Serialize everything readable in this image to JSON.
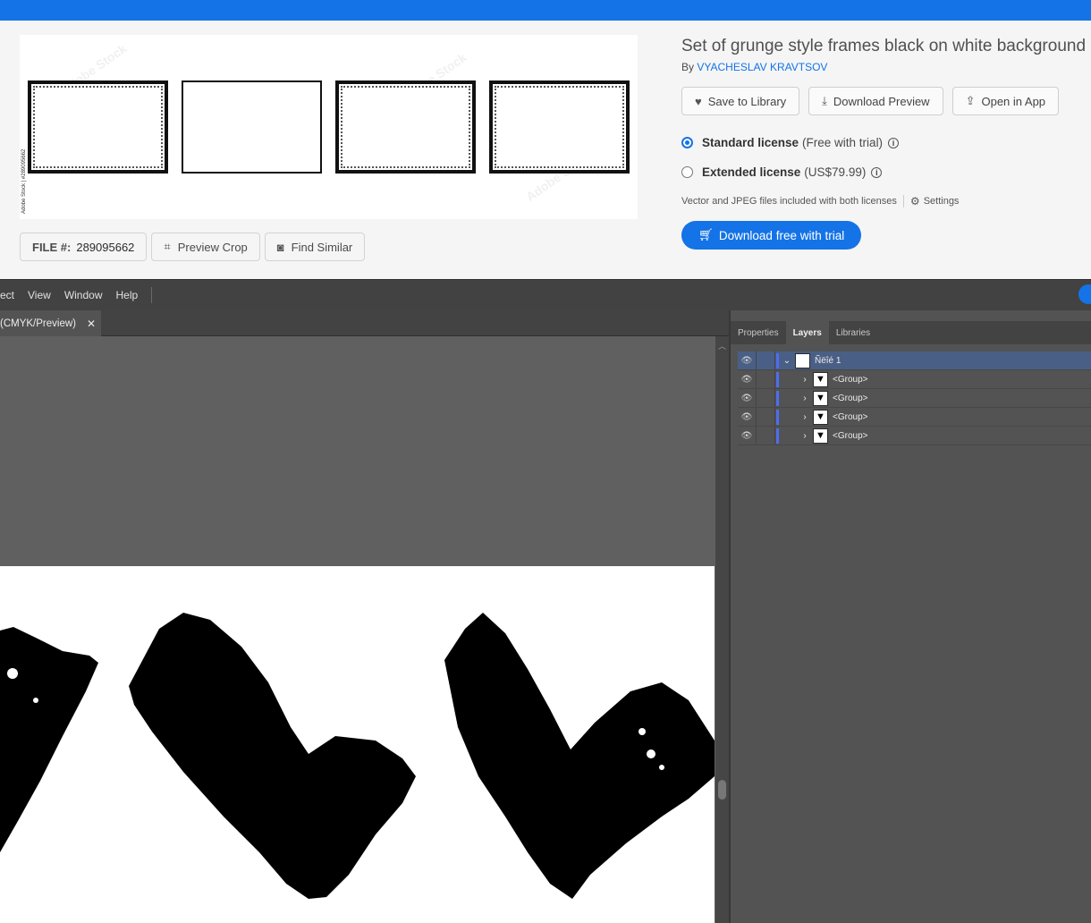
{
  "stock": {
    "title": "Set of grunge style frames black on white background",
    "by_prefix": "By",
    "author": "VYACHESLAV KRAVTSOV",
    "preview_credit": "Adobe Stock | #289095662",
    "watermark": "Adobe Stock",
    "actions": {
      "save": "Save to Library",
      "download_preview": "Download Preview",
      "open_in_app": "Open in App"
    },
    "licenses": [
      {
        "name": "Standard license",
        "note": "(Free with trial)",
        "selected": true
      },
      {
        "name": "Extended license",
        "note": "(US$79.99)",
        "selected": false
      }
    ],
    "files_note": "Vector and JPEG files included with both licenses",
    "settings": "Settings",
    "cta": "Download free with trial",
    "file_label": "FILE #:",
    "file_number": "289095662",
    "preview_crop": "Preview Crop",
    "find_similar": "Find Similar",
    "colors": {
      "accent": "#1473e6"
    }
  },
  "app": {
    "menu": [
      "ect",
      "View",
      "Window",
      "Help"
    ],
    "doc_tab": "(CMYK/Preview)",
    "panel_tabs": [
      "Properties",
      "Layers",
      "Libraries"
    ],
    "active_panel_tab": "Layers",
    "layers": [
      {
        "name": "Ñëîé 1",
        "expanded": true,
        "selected": true,
        "depth": 0
      },
      {
        "name": "<Group>",
        "expanded": false,
        "selected": false,
        "depth": 1
      },
      {
        "name": "<Group>",
        "expanded": false,
        "selected": false,
        "depth": 1
      },
      {
        "name": "<Group>",
        "expanded": false,
        "selected": false,
        "depth": 1
      },
      {
        "name": "<Group>",
        "expanded": false,
        "selected": false,
        "depth": 1
      }
    ]
  }
}
